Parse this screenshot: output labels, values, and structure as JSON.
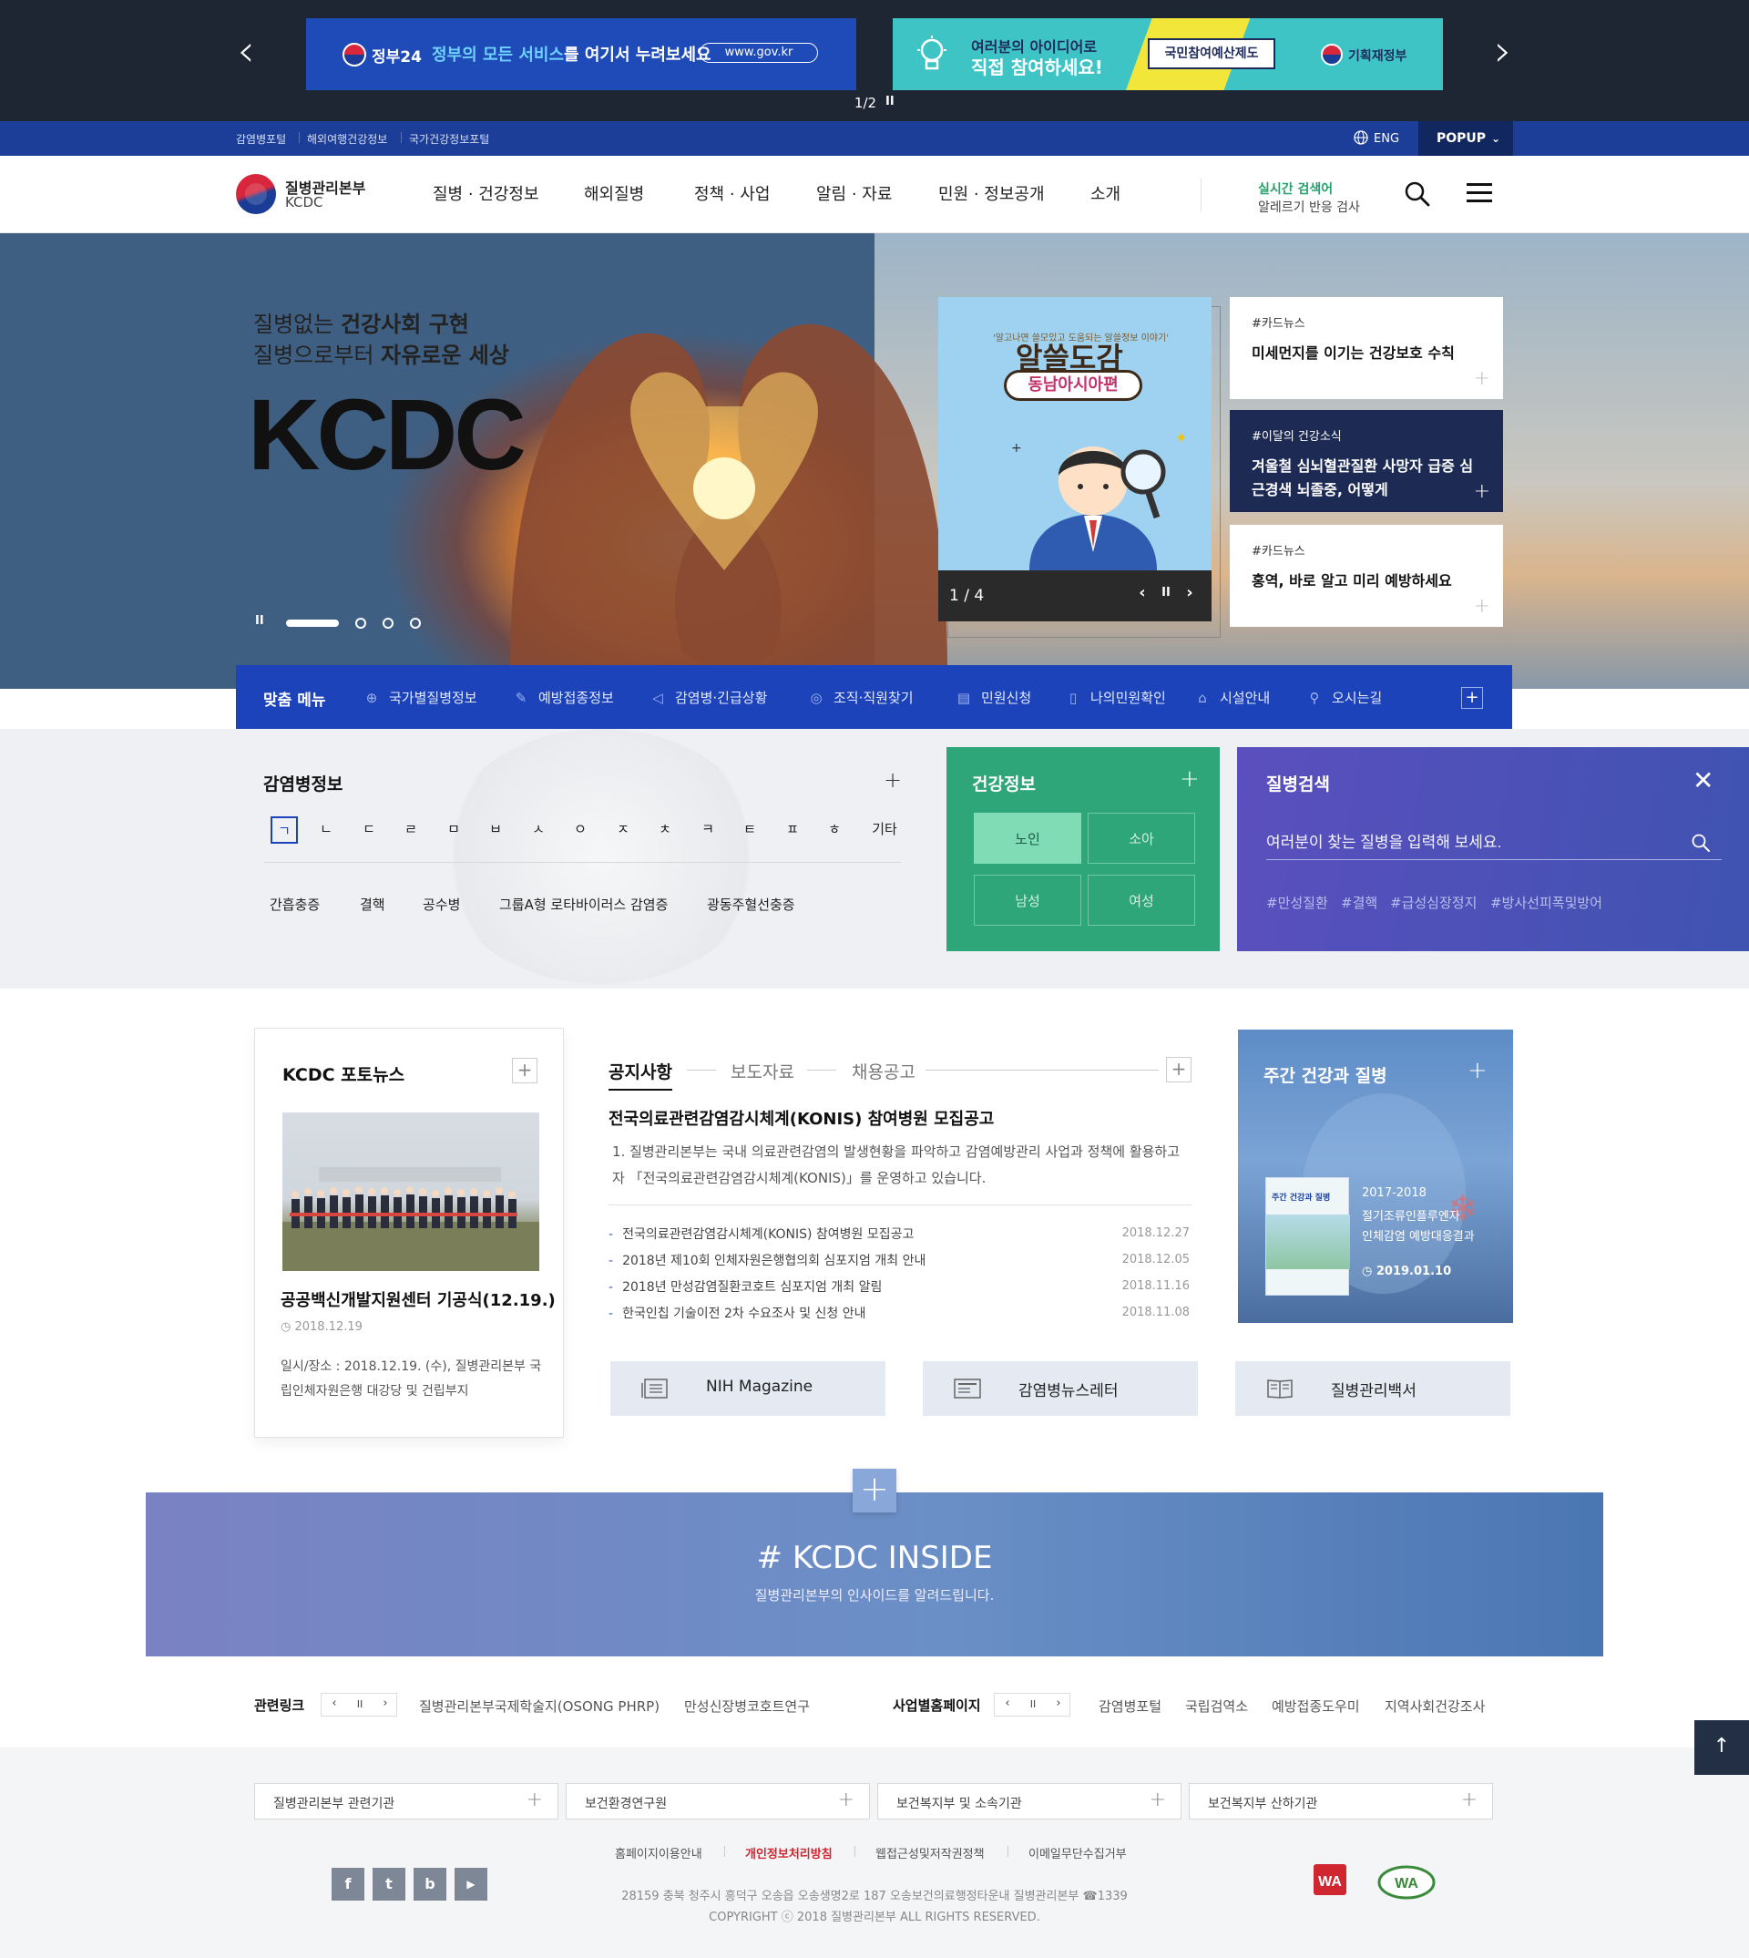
{
  "top_banner": {
    "prev": "‹",
    "next": "›",
    "gov24": {
      "name": "정부24",
      "text_a": "정부의 모든 서비스",
      "text_b": "를 여기서 누려보세요",
      "url": "www.gov.kr"
    },
    "idea": {
      "line1": "여러분의 아이디어로",
      "line2": "직접 참여하세요!",
      "box": "국민참여예산제도",
      "ministry": "기획재정부"
    },
    "counter": "1/2",
    "pause": "II"
  },
  "util_bar": {
    "links": [
      "감염병포털",
      "해외여행건강정보",
      "국가건강정보포털"
    ],
    "eng": "ENG",
    "popup": "POPUP"
  },
  "header": {
    "logo_ko": "질병관리본부",
    "logo_en": "KCDC",
    "gnb": [
      "질병 · 건강정보",
      "해외질병",
      "정책 · 사업",
      "알림 · 자료",
      "민원 · 정보공개",
      "소개"
    ],
    "realtime_label": "실시간 검색어",
    "realtime_word": "알레르기 반응 검사"
  },
  "hero": {
    "slogan1_a": "질병없는 ",
    "slogan1_b": "건강사회 구현",
    "slogan2_a": "질병으로부터 ",
    "slogan2_b": "자유로운 세상",
    "title": "KCDC",
    "pause": "II",
    "card": {
      "sub": "'알고나면 쓸모있고 도움되는 알쓸정보 이야기'",
      "title": "알쓸도감",
      "badge": "동남아시아편",
      "counter": "1 / 4",
      "prev": "‹",
      "pause": "II",
      "next": "›"
    },
    "news": [
      {
        "tag": "#카드뉴스",
        "title": "미세먼지를 이기는 건강보호 수칙"
      },
      {
        "tag": "#이달의 건강소식",
        "title": "겨울철 심뇌혈관질환 사망자 급증 심근경색 뇌졸중, 어떻게"
      },
      {
        "tag": "#카드뉴스",
        "title": "홍역, 바로 알고 미리 예방하세요"
      }
    ]
  },
  "quick_menu": {
    "title": "맞춤 메뉴",
    "items": [
      {
        "icon": "globe-icon",
        "glyph": "⊕",
        "label": "국가별질병정보"
      },
      {
        "icon": "syringe-icon",
        "glyph": "✎",
        "label": "예방접종정보"
      },
      {
        "icon": "megaphone-icon",
        "glyph": "◁",
        "label": "감염병·긴급상황"
      },
      {
        "icon": "location-person-icon",
        "glyph": "◎",
        "label": "조직·직원찾기"
      },
      {
        "icon": "document-icon",
        "glyph": "▤",
        "label": "민원신청"
      },
      {
        "icon": "phone-icon",
        "glyph": "▯",
        "label": "나의민원확인"
      },
      {
        "icon": "building-icon",
        "glyph": "⌂",
        "label": "시설안내"
      },
      {
        "icon": "map-pin-icon",
        "glyph": "⚲",
        "label": "오시는길"
      }
    ],
    "plus": "+"
  },
  "infect_info": {
    "title": "감염병정보",
    "consonants": [
      "ㄱ",
      "ㄴ",
      "ㄷ",
      "ㄹ",
      "ㅁ",
      "ㅂ",
      "ㅅ",
      "ㅇ",
      "ㅈ",
      "ㅊ",
      "ㅋ",
      "ㅌ",
      "ㅍ",
      "ㅎ",
      "기타"
    ],
    "diseases": [
      "간흡충증",
      "결핵",
      "공수병",
      "그룹A형 로타바이러스 감염증",
      "광동주혈선충증"
    ]
  },
  "health_info": {
    "title": "건강정보",
    "buttons": [
      "노인",
      "소아",
      "남성",
      "여성"
    ]
  },
  "disease_search": {
    "title": "질병검색",
    "placeholder": "여러분이 찾는 질병을 입력해 보세요.",
    "tags": [
      "#만성질환",
      "#결핵",
      "#급성심장정지",
      "#방사선피폭및방어"
    ]
  },
  "photo_news": {
    "title": "KCDC 포토뉴스",
    "caption": "공공백신개발지원센터 기공식(12.19.)",
    "date": "2018.12.19",
    "desc": "일시/장소 : 2018.12.19. (수), 질병관리본부 국립인체자원은행 대강당 및 건립부지"
  },
  "notice": {
    "tabs": [
      "공지사항",
      "보도자료",
      "채용공고"
    ],
    "headline": "전국의료관련감염감시체계(KONIS) 참여병원 모집공고",
    "summary": "1. 질병관리본부는 국내 의료관련감염의 발생현황을 파악하고 감염예방관리 사업과 정책에 활용하고자 「전국의료관련감염감시체계(KONIS)」를 운영하고 있습니다.",
    "rows": [
      {
        "title": "전국의료관련감염감시체계(KONIS) 참여병원 모집공고",
        "date": "2018.12.27"
      },
      {
        "title": "2018년 제10회 인체자원은행협의회 심포지엄 개최 안내",
        "date": "2018.12.05"
      },
      {
        "title": "2018년 만성감염질환코호트 심포지엄 개최 알림",
        "date": "2018.11.16"
      },
      {
        "title": "한국인칩 기술이전 2차 수요조사 및 신청 안내",
        "date": "2018.11.08"
      }
    ]
  },
  "weekly": {
    "title": "주간 건강과 질병",
    "cover_title": "주간 건강과 질병",
    "year": "2017-2018",
    "desc1": "절기조류인플루엔자",
    "desc2": "인체감염 예방대응결과",
    "date": "2019.01.10"
  },
  "publications": [
    {
      "icon": "magazine-icon",
      "label": "NIH Magazine"
    },
    {
      "icon": "newsletter-icon",
      "label": "감염병뉴스레터"
    },
    {
      "icon": "book-icon",
      "label": "질병관리백서"
    }
  ],
  "inside": {
    "plus": "+",
    "title": "# KCDC INSIDE",
    "sub": "질병관리본부의 인사이드를 알려드립니다."
  },
  "link_bar": {
    "related_title": "관련링크",
    "related_links": [
      "질병관리본부국제학술지(OSONG PHRP)",
      "만성신장병코호트연구"
    ],
    "business_title": "사업별홈페이지",
    "business_links": [
      "감염병포털",
      "국립검역소",
      "예방접종도우미",
      "지역사회건강조사"
    ],
    "prev": "‹",
    "pause": "II",
    "next": "›"
  },
  "footer": {
    "selects": [
      "질병관리본부 관련기관",
      "보건환경연구원",
      "보건복지부 및 소속기관",
      "보건복지부 산하기관"
    ],
    "links": [
      "홈페이지이용안내",
      "개인정보처리방침",
      "웹접근성및저작권정책",
      "이메일무단수집거부"
    ],
    "social": [
      {
        "icon": "facebook-icon",
        "glyph": "f"
      },
      {
        "icon": "twitter-icon",
        "glyph": "t"
      },
      {
        "icon": "blog-icon",
        "glyph": "b"
      },
      {
        "icon": "youtube-icon",
        "glyph": "▶"
      }
    ],
    "address": "28159 충북 청주시 흥덕구 오송읍 오송생명2로 187 오송보건의료행정타운내 질병관리본부 ☎1339",
    "copyright": "COPYRIGHT ⓒ 2018 질병관리본부 ALL RIGHTS RESERVED.",
    "award_web": "WA",
    "award_wa": "WA"
  },
  "to_top": "↑",
  "colors": {
    "brand_blue": "#1c43ba",
    "util_blue": "#1c3e99",
    "health_green": "#2ea67a",
    "search_purple": "#5b4fbe",
    "top_dark": "#1f2633"
  }
}
